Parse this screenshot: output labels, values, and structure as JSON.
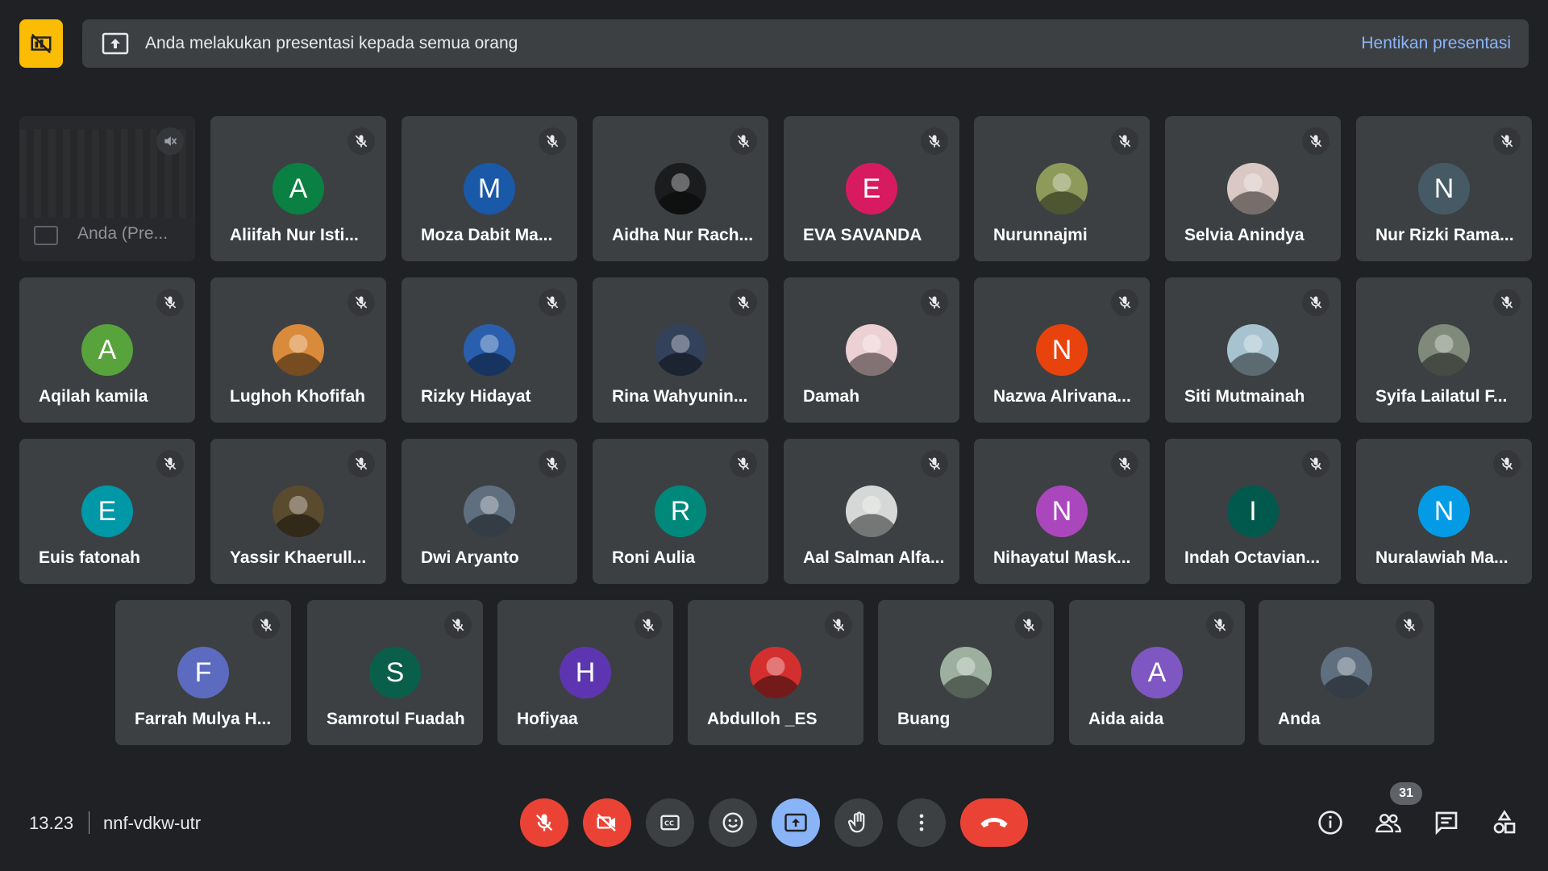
{
  "banner": {
    "text": "Anda melakukan presentasi kepada semua orang",
    "stop_label": "Hentikan presentasi"
  },
  "self_preview": {
    "name": "Anda (Pre..."
  },
  "participants": [
    {
      "name": "Aliifah Nur Isti...",
      "initial": "A",
      "color": "#0b8043"
    },
    {
      "name": "Moza Dabit Ma...",
      "initial": "M",
      "color": "#1a58a8"
    },
    {
      "name": "Aidha Nur Rach...",
      "initial": "",
      "color": "#1b1c1e",
      "photo": "dark-photo"
    },
    {
      "name": "EVA SAVANDA",
      "initial": "E",
      "color": "#d81b60"
    },
    {
      "name": "Nurunnajmi",
      "initial": "",
      "color": "#8d9a5a",
      "photo": "outdoor-photo"
    },
    {
      "name": "Selvia Anindya",
      "initial": "",
      "color": "#d9c8c3",
      "photo": "portrait-photo"
    },
    {
      "name": "Nur Rizki Rama...",
      "initial": "N",
      "color": "#455a64"
    },
    {
      "name": "Aqilah kamila",
      "initial": "A",
      "color": "#58a33c"
    },
    {
      "name": "Lughoh Khofifah",
      "initial": "",
      "color": "#d98a3a",
      "photo": "sunset-photo"
    },
    {
      "name": "Rizky Hidayat",
      "initial": "",
      "color": "#2a5fae",
      "photo": "banner-photo"
    },
    {
      "name": "Rina Wahyunin...",
      "initial": "",
      "color": "#33415a",
      "photo": "masked-photo"
    },
    {
      "name": "Damah",
      "initial": "",
      "color": "#ecd0d4",
      "photo": "light-photo"
    },
    {
      "name": "Nazwa Alrivana...",
      "initial": "N",
      "color": "#e8430c"
    },
    {
      "name": "Siti Mutmainah",
      "initial": "",
      "color": "#a7c3cf",
      "photo": "duo-photo"
    },
    {
      "name": "Syifa Lailatul F...",
      "initial": "",
      "color": "#7f8a7a",
      "photo": "street-photo"
    },
    {
      "name": "Euis fatonah",
      "initial": "E",
      "color": "#0097a7"
    },
    {
      "name": "Yassir Khaerull...",
      "initial": "",
      "color": "#5a4a2e",
      "photo": "forest-photo"
    },
    {
      "name": "Dwi Aryanto",
      "initial": "",
      "color": "#5f6f7f",
      "photo": "man-photo"
    },
    {
      "name": "Roni Aulia",
      "initial": "R",
      "color": "#00897b"
    },
    {
      "name": "Aal Salman Alfa...",
      "initial": "",
      "color": "#d5d8d6",
      "photo": "mask-photo"
    },
    {
      "name": "Nihayatul Mask...",
      "initial": "N",
      "color": "#ab47bc"
    },
    {
      "name": "Indah Octavian...",
      "initial": "I",
      "color": "#00594c"
    },
    {
      "name": "Nuralawiah Ma...",
      "initial": "N",
      "color": "#039be5"
    },
    {
      "name": "Farrah Mulya H...",
      "initial": "F",
      "color": "#5c6bc0"
    },
    {
      "name": "Samrotul Fuadah",
      "initial": "S",
      "color": "#0a5f4a"
    },
    {
      "name": "Hofiyaa",
      "initial": "H",
      "color": "#5e35b1"
    },
    {
      "name": "Abdulloh _ES",
      "initial": "",
      "color": "#d32f2f",
      "photo": "formal-photo"
    },
    {
      "name": "Buang",
      "initial": "",
      "color": "#9db0a0",
      "photo": "park-photo"
    },
    {
      "name": "Aida aida",
      "initial": "A",
      "color": "#7e57c2"
    },
    {
      "name": "Anda",
      "initial": "",
      "color": "#5f6f7f",
      "photo": "man-photo"
    }
  ],
  "bottom": {
    "time": "13.23",
    "meeting_code": "nnf-vdkw-utr",
    "participant_count": "31"
  },
  "colors": {
    "background": "#202124",
    "tile": "#3c4043",
    "accent": "#8ab4f8",
    "danger": "#ea4335",
    "warning": "#fbbc04"
  }
}
